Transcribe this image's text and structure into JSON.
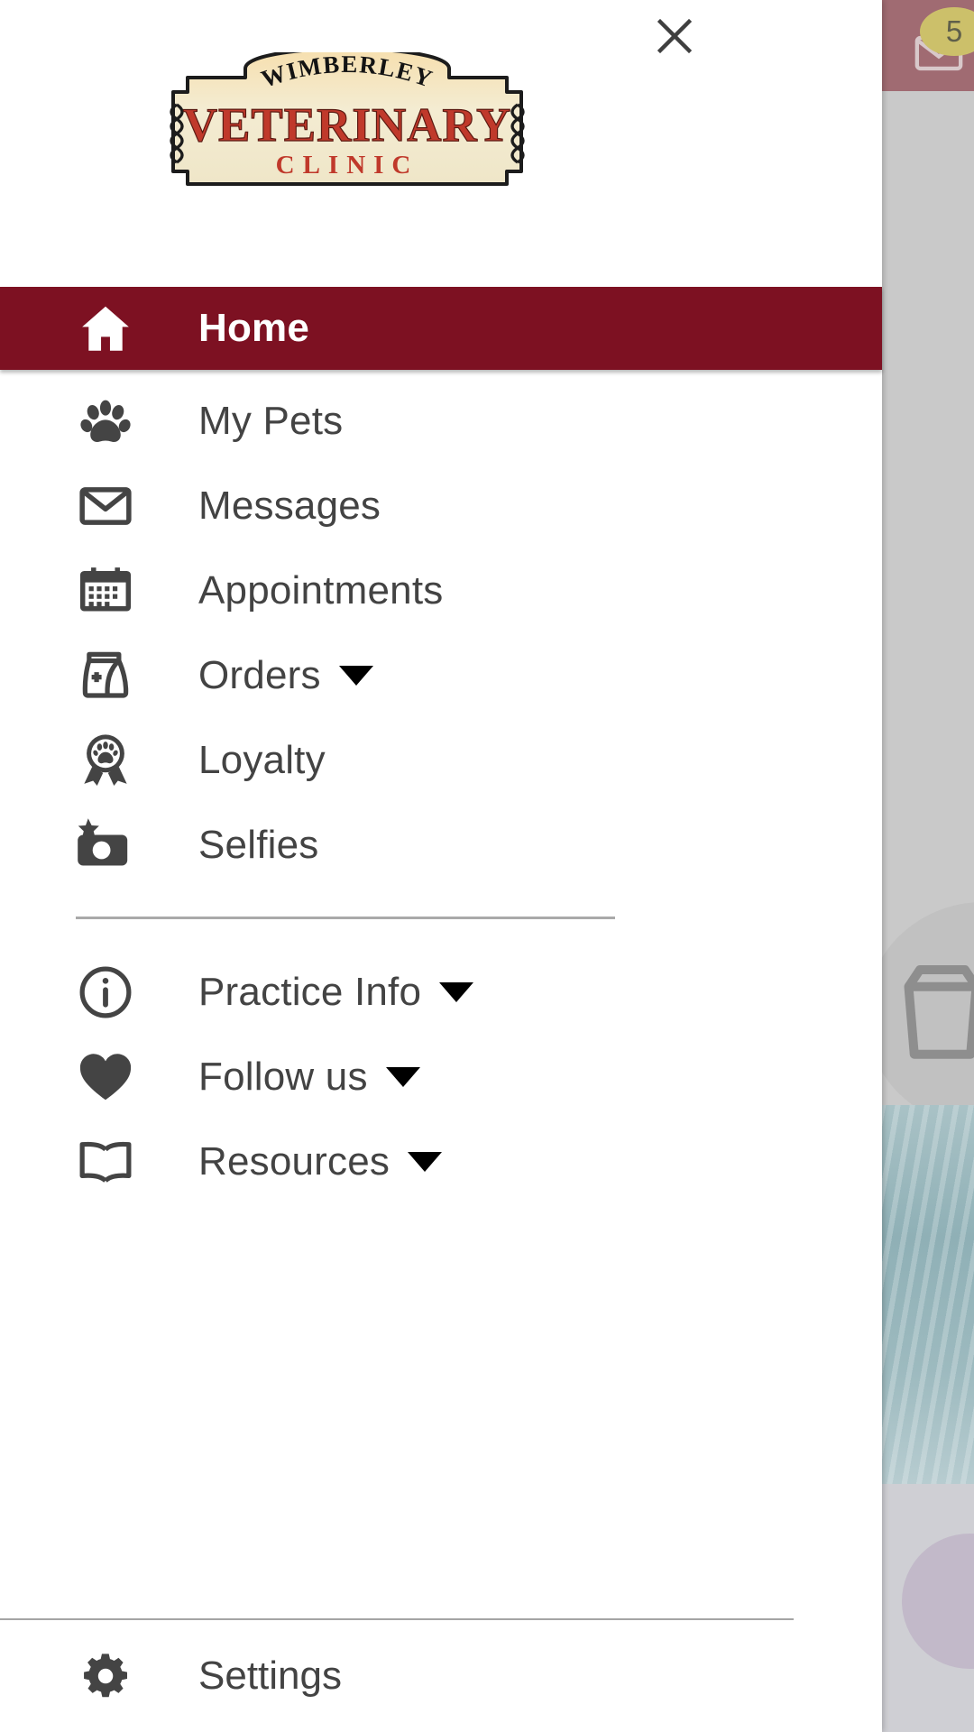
{
  "brand": {
    "logo_line1": "WIMBERLEY",
    "logo_line2": "VETERINARY",
    "logo_line3": "CLINIC",
    "accent_red": "#7d1122",
    "logo_text_red": "#c0392b",
    "logo_bg_cream": "#f2ead0"
  },
  "header": {
    "close_icon": "close-icon",
    "close_label": "Close menu"
  },
  "background": {
    "message_badge_count": "5",
    "mail_icon": "mail-icon",
    "header_color": "#a06b72",
    "badge_color": "#ccc06a"
  },
  "nav": {
    "primary": [
      {
        "label": "Home",
        "icon": "home-icon",
        "active": true,
        "has_caret": false
      },
      {
        "label": "My Pets",
        "icon": "paw-icon",
        "active": false,
        "has_caret": false
      },
      {
        "label": "Messages",
        "icon": "envelope-icon",
        "active": false,
        "has_caret": false
      },
      {
        "label": "Appointments",
        "icon": "calendar-icon",
        "active": false,
        "has_caret": false
      },
      {
        "label": "Orders",
        "icon": "food-bag-icon",
        "active": false,
        "has_caret": true
      },
      {
        "label": "Loyalty",
        "icon": "award-paw-icon",
        "active": false,
        "has_caret": false
      },
      {
        "label": "Selfies",
        "icon": "camera-icon",
        "active": false,
        "has_caret": false
      }
    ],
    "secondary": [
      {
        "label": "Practice Info",
        "icon": "info-circle-icon",
        "has_caret": true
      },
      {
        "label": "Follow us",
        "icon": "heart-icon",
        "has_caret": true
      },
      {
        "label": "Resources",
        "icon": "book-icon",
        "has_caret": true
      }
    ],
    "footer": {
      "label": "Settings",
      "icon": "gear-icon"
    }
  }
}
